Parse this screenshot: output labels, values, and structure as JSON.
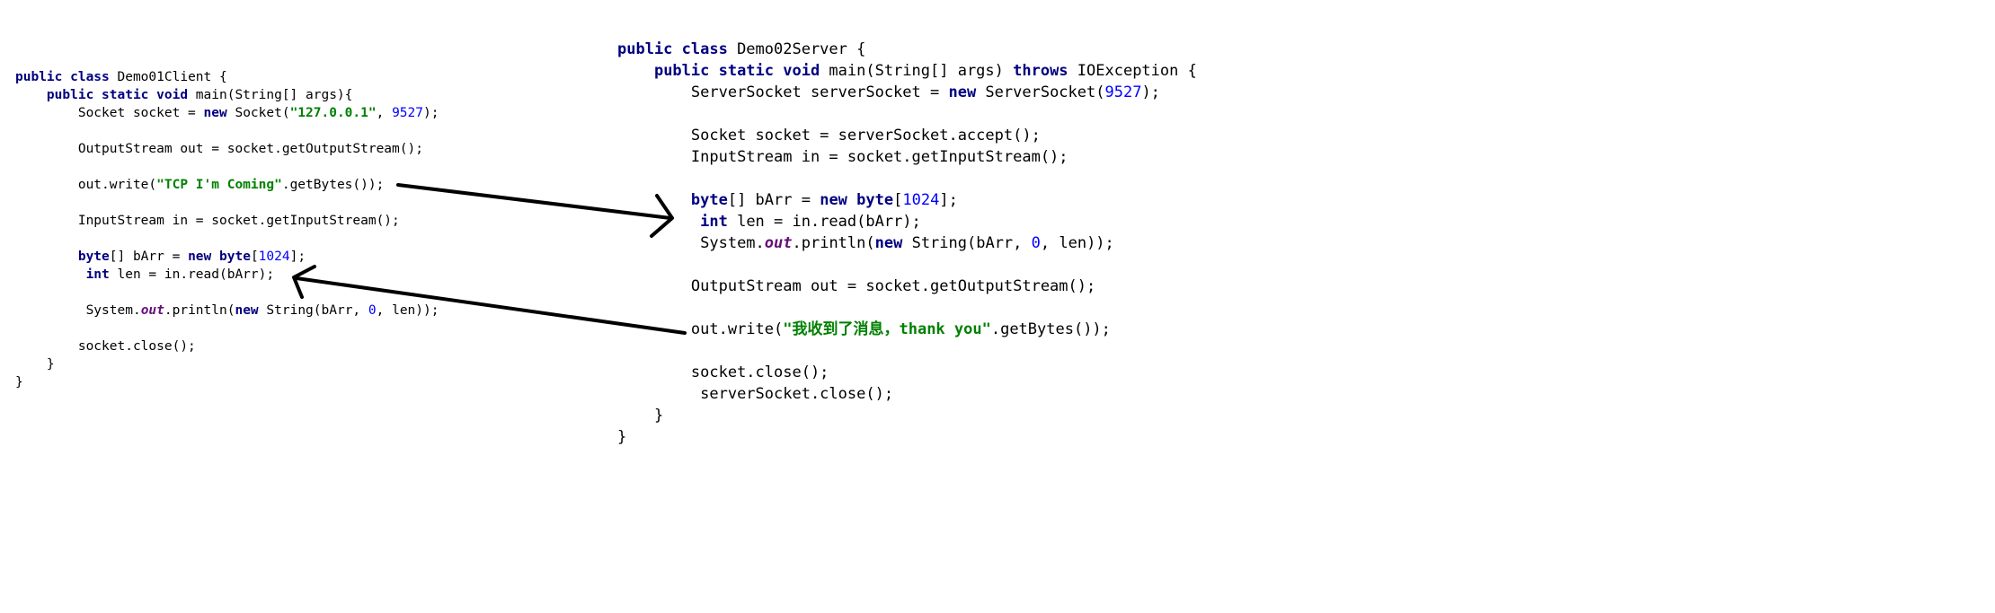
{
  "colors": {
    "background": "#ffffff",
    "text": "#000000",
    "keyword": "#000080",
    "string": "#008000",
    "number": "#0000ff",
    "static_field": "#660e7a",
    "arrow": "#000000"
  },
  "client": {
    "lines": [
      {
        "indent": 0,
        "tokens": [
          {
            "t": "kw",
            "v": "public class"
          },
          {
            "t": "plain",
            "v": " Demo01Client {"
          }
        ]
      },
      {
        "indent": 4,
        "tokens": [
          {
            "t": "kw",
            "v": "public static void"
          },
          {
            "t": "plain",
            "v": " main(String[] args){"
          }
        ]
      },
      {
        "indent": 8,
        "tokens": [
          {
            "t": "plain",
            "v": "Socket socket = "
          },
          {
            "t": "kw",
            "v": "new"
          },
          {
            "t": "plain",
            "v": " Socket("
          },
          {
            "t": "str",
            "v": "\"127.0.0.1\""
          },
          {
            "t": "plain",
            "v": ", "
          },
          {
            "t": "num",
            "v": "9527"
          },
          {
            "t": "plain",
            "v": ");"
          }
        ]
      },
      {
        "indent": 0,
        "tokens": []
      },
      {
        "indent": 8,
        "tokens": [
          {
            "t": "plain",
            "v": "OutputStream out = socket.getOutputStream();"
          }
        ]
      },
      {
        "indent": 0,
        "tokens": []
      },
      {
        "indent": 8,
        "tokens": [
          {
            "t": "plain",
            "v": "out.write("
          },
          {
            "t": "str",
            "v": "\"TCP I'm Coming\""
          },
          {
            "t": "plain",
            "v": ".getBytes());"
          }
        ]
      },
      {
        "indent": 0,
        "tokens": []
      },
      {
        "indent": 8,
        "tokens": [
          {
            "t": "plain",
            "v": "InputStream in = socket.getInputStream();"
          }
        ]
      },
      {
        "indent": 0,
        "tokens": []
      },
      {
        "indent": 8,
        "tokens": [
          {
            "t": "kw",
            "v": "byte"
          },
          {
            "t": "plain",
            "v": "[] bArr = "
          },
          {
            "t": "kw",
            "v": "new"
          },
          {
            "t": "plain",
            "v": " "
          },
          {
            "t": "kw",
            "v": "byte"
          },
          {
            "t": "plain",
            "v": "["
          },
          {
            "t": "num",
            "v": "1024"
          },
          {
            "t": "plain",
            "v": "];"
          }
        ]
      },
      {
        "indent": 9,
        "tokens": [
          {
            "t": "kw",
            "v": "int"
          },
          {
            "t": "plain",
            "v": " len = in.read(bArr);"
          }
        ]
      },
      {
        "indent": 0,
        "tokens": []
      },
      {
        "indent": 9,
        "tokens": [
          {
            "t": "plain",
            "v": "System."
          },
          {
            "t": "static",
            "v": "out"
          },
          {
            "t": "plain",
            "v": ".println("
          },
          {
            "t": "kw",
            "v": "new"
          },
          {
            "t": "plain",
            "v": " String(bArr, "
          },
          {
            "t": "num",
            "v": "0"
          },
          {
            "t": "plain",
            "v": ", len));"
          }
        ]
      },
      {
        "indent": 0,
        "tokens": []
      },
      {
        "indent": 8,
        "tokens": [
          {
            "t": "plain",
            "v": "socket.close();"
          }
        ]
      },
      {
        "indent": 4,
        "tokens": [
          {
            "t": "plain",
            "v": "}"
          }
        ]
      },
      {
        "indent": 0,
        "tokens": [
          {
            "t": "plain",
            "v": "}"
          }
        ]
      }
    ]
  },
  "server": {
    "lines": [
      {
        "indent": 0,
        "tokens": [
          {
            "t": "kw",
            "v": "public class"
          },
          {
            "t": "plain",
            "v": " Demo02Server {"
          }
        ]
      },
      {
        "indent": 4,
        "tokens": [
          {
            "t": "kw",
            "v": "public static void"
          },
          {
            "t": "plain",
            "v": " main(String[] args) "
          },
          {
            "t": "kw",
            "v": "throws"
          },
          {
            "t": "plain",
            "v": " IOException {"
          }
        ]
      },
      {
        "indent": 8,
        "tokens": [
          {
            "t": "plain",
            "v": "ServerSocket serverSocket = "
          },
          {
            "t": "kw",
            "v": "new"
          },
          {
            "t": "plain",
            "v": " ServerSocket("
          },
          {
            "t": "num",
            "v": "9527"
          },
          {
            "t": "plain",
            "v": ");"
          }
        ]
      },
      {
        "indent": 0,
        "tokens": []
      },
      {
        "indent": 8,
        "tokens": [
          {
            "t": "plain",
            "v": "Socket socket = serverSocket.accept();"
          }
        ]
      },
      {
        "indent": 8,
        "tokens": [
          {
            "t": "plain",
            "v": "InputStream in = socket.getInputStream();"
          }
        ]
      },
      {
        "indent": 0,
        "tokens": []
      },
      {
        "indent": 8,
        "tokens": [
          {
            "t": "kw",
            "v": "byte"
          },
          {
            "t": "plain",
            "v": "[] bArr = "
          },
          {
            "t": "kw",
            "v": "new"
          },
          {
            "t": "plain",
            "v": " "
          },
          {
            "t": "kw",
            "v": "byte"
          },
          {
            "t": "plain",
            "v": "["
          },
          {
            "t": "num",
            "v": "1024"
          },
          {
            "t": "plain",
            "v": "];"
          }
        ]
      },
      {
        "indent": 9,
        "tokens": [
          {
            "t": "kw",
            "v": "int"
          },
          {
            "t": "plain",
            "v": " len = in.read(bArr);"
          }
        ]
      },
      {
        "indent": 9,
        "tokens": [
          {
            "t": "plain",
            "v": "System."
          },
          {
            "t": "static",
            "v": "out"
          },
          {
            "t": "plain",
            "v": ".println("
          },
          {
            "t": "kw",
            "v": "new"
          },
          {
            "t": "plain",
            "v": " String(bArr, "
          },
          {
            "t": "num",
            "v": "0"
          },
          {
            "t": "plain",
            "v": ", len));"
          }
        ]
      },
      {
        "indent": 0,
        "tokens": []
      },
      {
        "indent": 8,
        "tokens": [
          {
            "t": "plain",
            "v": "OutputStream out = socket.getOutputStream();"
          }
        ]
      },
      {
        "indent": 0,
        "tokens": []
      },
      {
        "indent": 8,
        "tokens": [
          {
            "t": "plain",
            "v": "out.write("
          },
          {
            "t": "str",
            "v": "\"我收到了消息，thank you\""
          },
          {
            "t": "plain",
            "v": ".getBytes());"
          }
        ]
      },
      {
        "indent": 0,
        "tokens": []
      },
      {
        "indent": 8,
        "tokens": [
          {
            "t": "plain",
            "v": "socket.close();"
          }
        ]
      },
      {
        "indent": 9,
        "tokens": [
          {
            "t": "plain",
            "v": "serverSocket.close();"
          }
        ]
      },
      {
        "indent": 4,
        "tokens": [
          {
            "t": "plain",
            "v": "}"
          }
        ]
      },
      {
        "indent": 0,
        "tokens": [
          {
            "t": "plain",
            "v": "}"
          }
        ]
      }
    ]
  },
  "arrows": [
    {
      "name": "client-write-to-server-read-arrow",
      "from": "client.out.write",
      "to": "server.byte[] bArr"
    },
    {
      "name": "server-write-to-client-read-arrow",
      "from": "server.out.write",
      "to": "client.int len"
    }
  ]
}
